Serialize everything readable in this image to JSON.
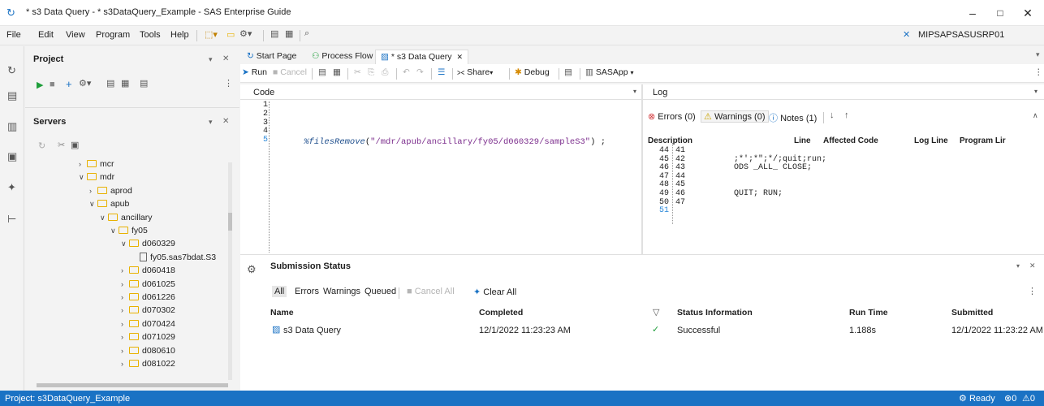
{
  "window": {
    "title": "* s3 Data Query - * s3DataQuery_Example - SAS Enterprise Guide",
    "user": "MIPSAPSASUSRP01"
  },
  "menu": [
    "File",
    "Edit",
    "View",
    "Program",
    "Tools",
    "Help"
  ],
  "project_panel": {
    "title": "Project"
  },
  "servers_panel": {
    "title": "Servers"
  },
  "tree": [
    {
      "label": "mcr",
      "depth": 0,
      "expanded": false,
      "type": "folder"
    },
    {
      "label": "mdr",
      "depth": 0,
      "expanded": true,
      "type": "folder"
    },
    {
      "label": "aprod",
      "depth": 1,
      "expanded": false,
      "type": "folder"
    },
    {
      "label": "apub",
      "depth": 1,
      "expanded": true,
      "type": "folder"
    },
    {
      "label": "ancillary",
      "depth": 2,
      "expanded": true,
      "type": "folder"
    },
    {
      "label": "fy05",
      "depth": 3,
      "expanded": true,
      "type": "folder"
    },
    {
      "label": "d060329",
      "depth": 4,
      "expanded": true,
      "type": "folder"
    },
    {
      "label": "fy05.sas7bdat.S3",
      "depth": 5,
      "expanded": null,
      "type": "file"
    },
    {
      "label": "d060418",
      "depth": 4,
      "expanded": false,
      "type": "folder"
    },
    {
      "label": "d061025",
      "depth": 4,
      "expanded": false,
      "type": "folder"
    },
    {
      "label": "d061226",
      "depth": 4,
      "expanded": false,
      "type": "folder"
    },
    {
      "label": "d070302",
      "depth": 4,
      "expanded": false,
      "type": "folder"
    },
    {
      "label": "d070424",
      "depth": 4,
      "expanded": false,
      "type": "folder"
    },
    {
      "label": "d071029",
      "depth": 4,
      "expanded": false,
      "type": "folder"
    },
    {
      "label": "d080610",
      "depth": 4,
      "expanded": false,
      "type": "folder"
    },
    {
      "label": "d081022",
      "depth": 4,
      "expanded": false,
      "type": "folder"
    }
  ],
  "tabs": [
    {
      "label": "Start Page",
      "active": false
    },
    {
      "label": "Process Flow",
      "active": false
    },
    {
      "label": "* s3 Data Query",
      "active": true
    }
  ],
  "toolbar": {
    "run": "Run",
    "cancel": "Cancel",
    "share": "Share",
    "debug": "Debug",
    "server": "SASApp"
  },
  "code": {
    "header": "Code",
    "lines": [
      "1",
      "2",
      "3",
      "4",
      "5"
    ],
    "macro": "%filesRemove",
    "arg": "\"/mdr/apub/ancillary/fy05/d060329/sampleS3\"",
    "tail": " ;"
  },
  "log": {
    "header": "Log",
    "errors": "Errors (0)",
    "warnings": "Warnings (0)",
    "notes": "Notes (1)",
    "columns": [
      "Description",
      "Line",
      "Affected Code",
      "Log Line",
      "Program Lir"
    ],
    "rows": [
      {
        "a": "44",
        "b": "41",
        "t": ""
      },
      {
        "a": "45",
        "b": "42",
        "t": ";*';*\";*/;quit;run;"
      },
      {
        "a": "46",
        "b": "43",
        "t": "ODS _ALL_ CLOSE;"
      },
      {
        "a": "47",
        "b": "44",
        "t": ""
      },
      {
        "a": "48",
        "b": "45",
        "t": ""
      },
      {
        "a": "49",
        "b": "46",
        "t": "QUIT; RUN;"
      },
      {
        "a": "50",
        "b": "47",
        "t": ""
      },
      {
        "a": "51",
        "b": "",
        "t": ""
      }
    ]
  },
  "submission": {
    "title": "Submission Status",
    "filters": [
      "All",
      "Errors",
      "Warnings",
      "Queued"
    ],
    "cancel_all": "Cancel All",
    "clear_all": "Clear All",
    "columns": {
      "name": "Name",
      "completed": "Completed",
      "status": "Status Information",
      "runtime": "Run Time",
      "submitted": "Submitted"
    },
    "rows": [
      {
        "name": "s3 Data Query",
        "completed": "12/1/2022 11:23:23 AM",
        "status": "Successful",
        "runtime": "1.188s",
        "submitted": "12/1/2022 11:23:22 AM"
      }
    ]
  },
  "statusbar": {
    "project": "Project: s3DataQuery_Example",
    "ready": "Ready",
    "errors": "0",
    "warnings": "0"
  }
}
